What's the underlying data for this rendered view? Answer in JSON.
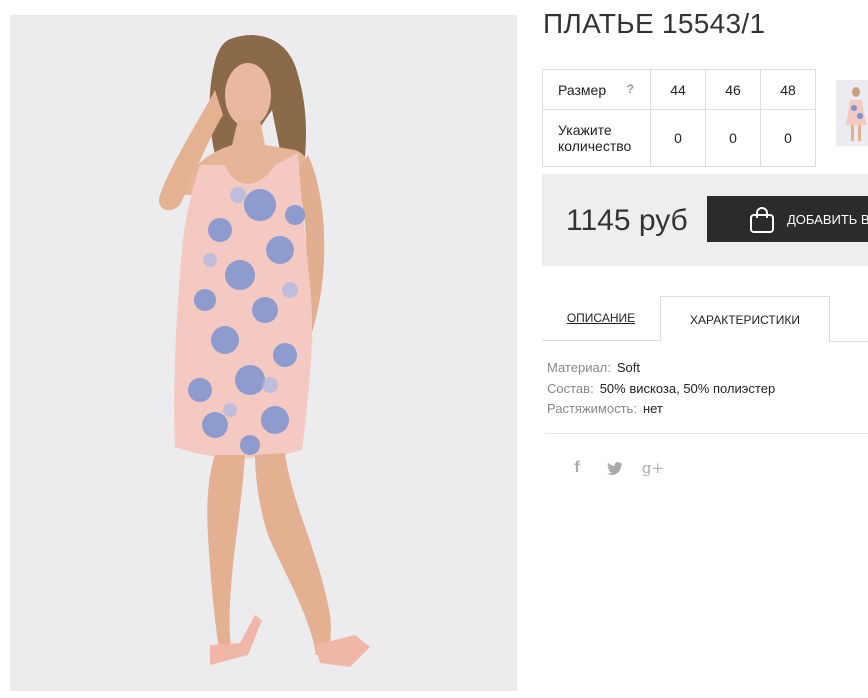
{
  "product": {
    "title": "ПЛАТЬЕ 15543/1"
  },
  "size_table": {
    "size_label": "Размер",
    "help_mark": "?",
    "sizes": [
      "44",
      "46",
      "48"
    ],
    "quantity_label": "Укажите количество",
    "quantities": [
      "0",
      "0",
      "0"
    ]
  },
  "purchase": {
    "price": "1145 руб",
    "add_button_label": "ДОБАВИТЬ В"
  },
  "tabs": {
    "description": "ОПИСАНИЕ",
    "characteristics": "ХАРАКТЕРИСТИКИ",
    "active": "characteristics"
  },
  "specs": [
    {
      "key": "Материал:",
      "value": "Soft"
    },
    {
      "key": "Состав:",
      "value": "50% вискоза, 50% полиэстер"
    },
    {
      "key": "Растяжимость:",
      "value": "нет"
    }
  ],
  "social": {
    "facebook": "f",
    "google": "g+"
  },
  "colors": {
    "button_bg": "#2b2b2b",
    "price_bg": "#eeeeee",
    "dress_pink": "#f3c9c2",
    "dress_blue": "#7c93d2"
  }
}
